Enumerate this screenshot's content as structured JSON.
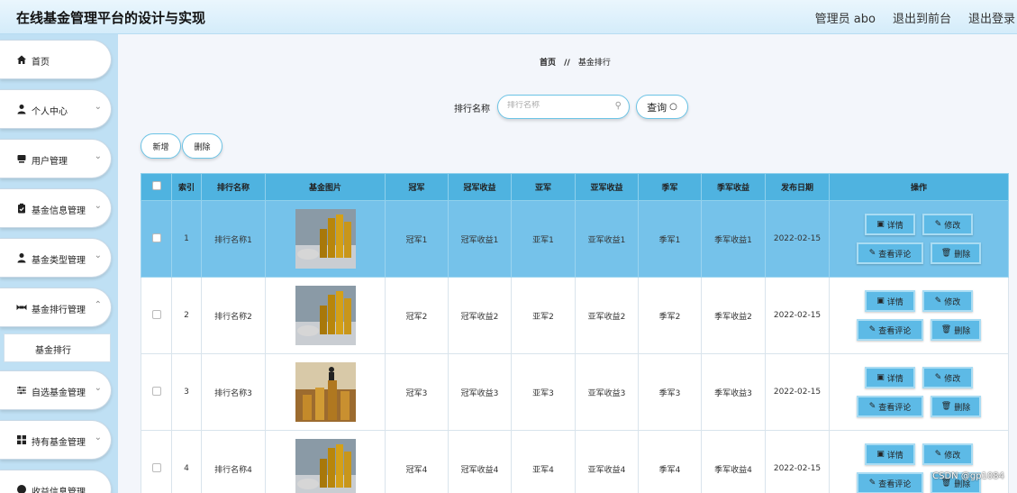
{
  "app": {
    "title": "在线基金管理平台的设计与实现",
    "admin": "管理员 abo",
    "to_front": "退出到前台",
    "logout": "退出登录"
  },
  "sidebar": {
    "items": [
      {
        "label": "首页",
        "icon": "home-icon"
      },
      {
        "label": "个人中心",
        "icon": "user-icon"
      },
      {
        "label": "用户管理",
        "icon": "users-icon"
      },
      {
        "label": "基金信息管理",
        "icon": "clipboard-icon"
      },
      {
        "label": "基金类型管理",
        "icon": "user-icon"
      },
      {
        "label": "基金排行管理",
        "icon": "ranking-icon"
      },
      {
        "label": "自选基金管理",
        "icon": "sliders-icon"
      },
      {
        "label": "持有基金管理",
        "icon": "grid-icon"
      },
      {
        "label": "收益信息管理",
        "icon": "circle-icon"
      }
    ],
    "sub_item": "基金排行"
  },
  "breadcrumb": {
    "home": "首页",
    "sep": "//",
    "current": "基金排行"
  },
  "search": {
    "label": "排行名称",
    "placeholder": "排行名称",
    "button": "查询"
  },
  "actions": {
    "add": "新增",
    "delete": "删除"
  },
  "table": {
    "headers": [
      "索引",
      "排行名称",
      "基金图片",
      "冠军",
      "冠军收益",
      "亚军",
      "亚军收益",
      "季军",
      "季军收益",
      "发布日期",
      "操作"
    ],
    "rows": [
      {
        "index": "1",
        "name": "排行名称1",
        "champion": "冠军1",
        "champion_profit": "冠军收益1",
        "runner_up": "亚军1",
        "runner_up_profit": "亚军收益1",
        "third": "季军1",
        "third_profit": "季军收益1",
        "date": "2022-02-15",
        "selected": true
      },
      {
        "index": "2",
        "name": "排行名称2",
        "champion": "冠军2",
        "champion_profit": "冠军收益2",
        "runner_up": "亚军2",
        "runner_up_profit": "亚军收益2",
        "third": "季军2",
        "third_profit": "季军收益2",
        "date": "2022-02-15",
        "selected": false
      },
      {
        "index": "3",
        "name": "排行名称3",
        "champion": "冠军3",
        "champion_profit": "冠军收益3",
        "runner_up": "亚军3",
        "runner_up_profit": "亚军收益3",
        "third": "季军3",
        "third_profit": "季军收益3",
        "date": "2022-02-15",
        "selected": false
      },
      {
        "index": "4",
        "name": "排行名称4",
        "champion": "冠军4",
        "champion_profit": "冠军收益4",
        "runner_up": "亚军4",
        "runner_up_profit": "亚军收益4",
        "third": "季军4",
        "third_profit": "季军收益4",
        "date": "2022-02-15",
        "selected": false
      }
    ],
    "row_ops": {
      "detail": "详情",
      "edit": "修改",
      "comments": "查看评论",
      "delete": "删除"
    }
  },
  "watermark": "CSDN @gp1084",
  "colors": {
    "header_bg": "#4fb3e0",
    "selected_row": "#75c2ea",
    "op_button": "#5dbae6",
    "sidebar_bg": "#bfe0f4"
  }
}
